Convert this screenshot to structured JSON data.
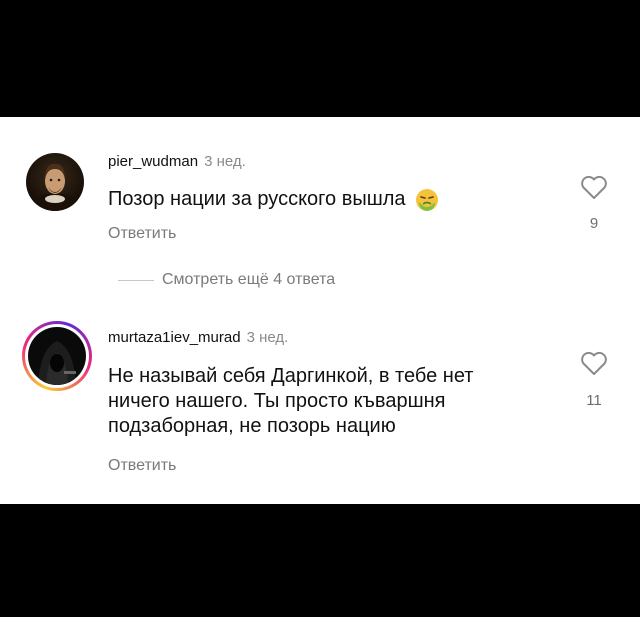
{
  "comments": [
    {
      "username": "pier_wudman",
      "time": "3 нед.",
      "text": "Позор нации за русского вышла",
      "emoji": "nauseated-face",
      "reply": "Ответить",
      "likes": "9"
    },
    {
      "username": "murtaza1iev_murad",
      "time": "3 нед.",
      "text_lines": [
        "Не называй себя Даргинкой, в тебе нет",
        "ничего нашего. Ты просто къваршня",
        "подзаборная, не позорь нацию"
      ],
      "reply": "Ответить",
      "likes": "11"
    }
  ],
  "view_more": "Смотреть ещё 4 ответа",
  "colors": {
    "background": "#000000",
    "panel": "#ffffff",
    "secondary_text": "#7a7a7a",
    "story_ring": [
      "#f9ce34",
      "#ee2a7b",
      "#6228d7"
    ]
  }
}
